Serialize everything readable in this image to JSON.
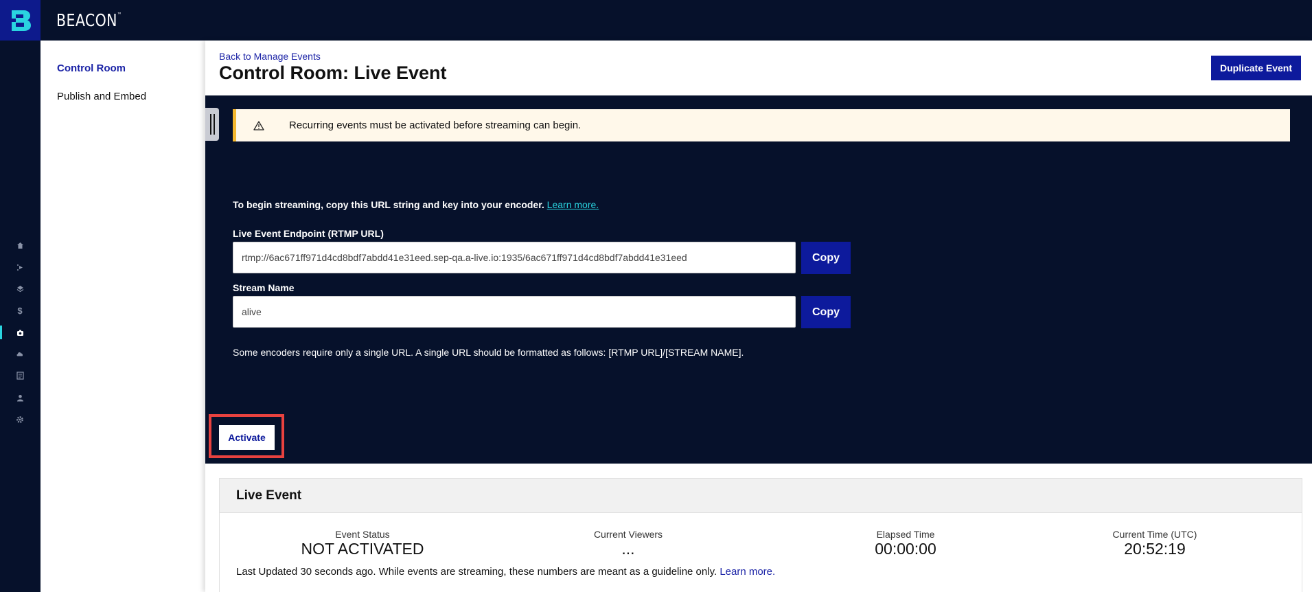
{
  "brand": {
    "name": "BEACON",
    "trademark": "™"
  },
  "rail": {
    "icons": [
      "home-icon",
      "play-icon",
      "layers-icon",
      "dollar-icon",
      "camera-icon",
      "cloud-icon",
      "report-icon",
      "user-icon",
      "gear-icon"
    ],
    "dollar_glyph": "$"
  },
  "subnav": {
    "items": [
      {
        "label": "Control Room",
        "active": true
      },
      {
        "label": "Publish and Embed",
        "active": false
      }
    ]
  },
  "header": {
    "back_link": "Back to Manage Events",
    "title": "Control Room: Live Event",
    "duplicate_label": "Duplicate Event"
  },
  "alert": {
    "text": "Recurring events must be activated before streaming can begin."
  },
  "streaming": {
    "instructions": "To begin streaming, copy this URL string and key into your encoder.",
    "learn_more": "Learn more.",
    "endpoint_label": "Live Event Endpoint (RTMP URL)",
    "endpoint_value": "rtmp://6ac671ff971d4cd8bdf7abdd41e31eed.sep-qa.a-live.io:1935/6ac671ff971d4cd8bdf7abdd41e31eed",
    "stream_name_label": "Stream Name",
    "stream_name_value": "alive",
    "copy_label": "Copy",
    "encoder_note": "Some encoders require only a single URL. A single URL should be formatted as follows: [RTMP URL]/[STREAM NAME]."
  },
  "activate": {
    "label": "Activate"
  },
  "live_event": {
    "title": "Live Event",
    "stats": [
      {
        "label": "Event Status",
        "value": "NOT ACTIVATED"
      },
      {
        "label": "Current Viewers",
        "value": "..."
      },
      {
        "label": "Elapsed Time",
        "value": "00:00:00"
      },
      {
        "label": "Current Time (UTC)",
        "value": "20:52:19"
      }
    ],
    "updated_text": "Last Updated 30 seconds ago. While events are streaming, these numbers are meant as a guideline only.",
    "learn_more": "Learn more."
  },
  "colors": {
    "navy": "#06112b",
    "brand_blue": "#0d1a9c",
    "accent_cyan": "#2ad4e0",
    "alert_bg": "#fff8ea",
    "alert_border": "#f5b82e",
    "highlight_red": "#e8423f"
  }
}
